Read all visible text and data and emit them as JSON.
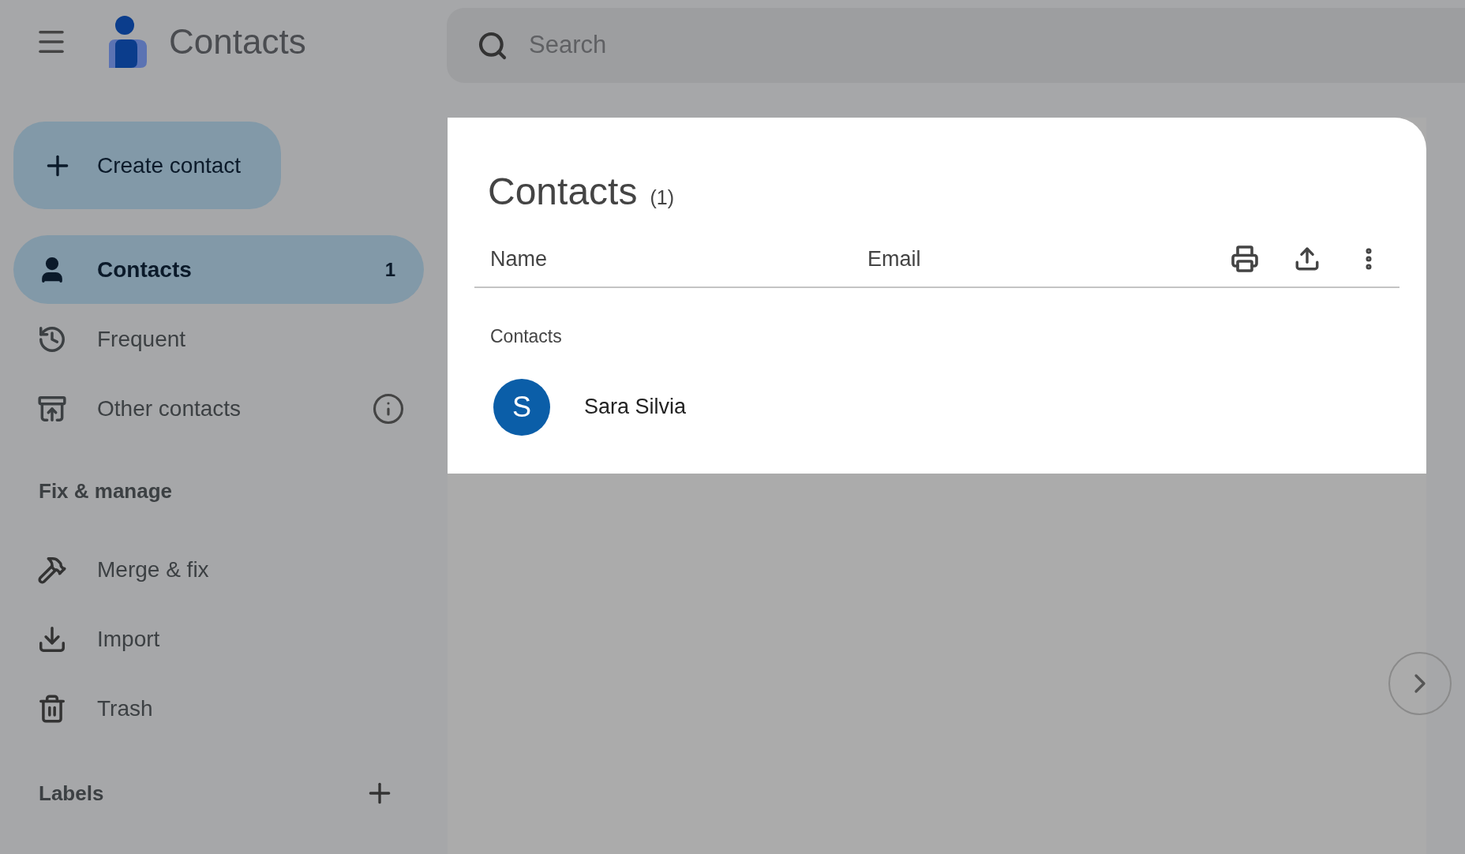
{
  "app": {
    "title": "Contacts"
  },
  "search": {
    "placeholder": "Search"
  },
  "create_button": {
    "label": "Create contact"
  },
  "nav": [
    {
      "label": "Contacts",
      "count": "1",
      "selected": true,
      "kind": "person",
      "info": false
    },
    {
      "label": "Frequent",
      "selected": false,
      "kind": "history",
      "info": false
    },
    {
      "label": "Other contacts",
      "selected": false,
      "kind": "archive",
      "info": true
    }
  ],
  "fix_manage": {
    "title": "Fix & manage",
    "items": [
      {
        "label": "Merge & fix",
        "kind": "tools"
      },
      {
        "label": "Import",
        "kind": "import"
      },
      {
        "label": "Trash",
        "kind": "trash"
      }
    ]
  },
  "labels": {
    "title": "Labels"
  },
  "list": {
    "title": "Contacts",
    "count": "(1)",
    "columns": [
      "Name",
      "Email"
    ],
    "group": "Contacts",
    "rows": [
      {
        "initial": "S",
        "name": "Sara Silvia",
        "color": "#0b5ea8"
      }
    ]
  }
}
